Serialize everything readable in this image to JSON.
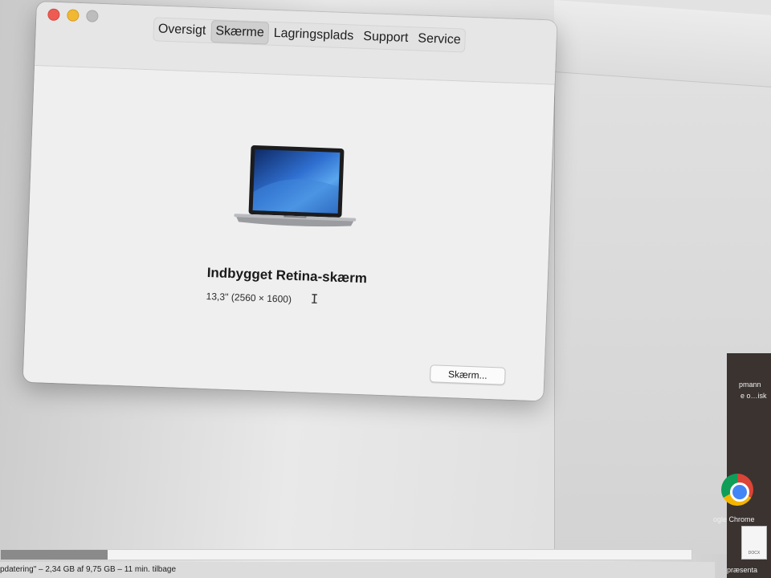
{
  "window": {
    "tabs": [
      {
        "label": "Oversigt"
      },
      {
        "label": "Skærme",
        "active": true
      },
      {
        "label": "Lagringsplads"
      },
      {
        "label": "Support"
      },
      {
        "label": "Service"
      }
    ],
    "display_name": "Indbygget Retina-skærm",
    "display_spec": "13,3'' (2560 × 1600)",
    "display_button": "Skærm..."
  },
  "status": {
    "text": "pdatering\" – 2,34 GB af 9,75 GB – 11 min. tilbage",
    "progress": 0.155
  },
  "desktop": {
    "label_1": "pmann",
    "label_2": "e o…isk",
    "chrome_label": "ogle Chrome",
    "doc_label": "præsenta",
    "doc_badge": "DOCX"
  },
  "colors": {
    "close": "#ee5b52",
    "minimize": "#f1b833",
    "zoom": "#bdbdbd"
  }
}
